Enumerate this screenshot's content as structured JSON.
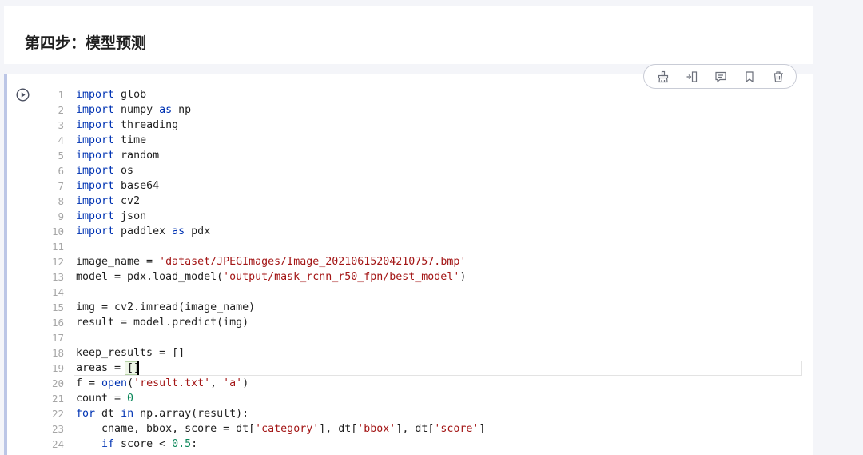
{
  "markdown": {
    "title": "第四步：模型预测"
  },
  "toolbar": {
    "buttons": [
      {
        "name": "clear-output",
        "icon": "broom-icon"
      },
      {
        "name": "insert-cell",
        "icon": "insert-cell-icon"
      },
      {
        "name": "comment",
        "icon": "comment-icon"
      },
      {
        "name": "bookmark",
        "icon": "bookmark-icon"
      },
      {
        "name": "delete",
        "icon": "trash-icon"
      }
    ]
  },
  "cell": {
    "run_icon": "play-circle-icon",
    "line_numbers": [
      "1",
      "2",
      "3",
      "4",
      "5",
      "6",
      "7",
      "8",
      "9",
      "10",
      "11",
      "12",
      "13",
      "14",
      "15",
      "16",
      "17",
      "18",
      "19",
      "20",
      "21",
      "22",
      "23",
      "24"
    ],
    "lines": [
      [
        [
          "kw",
          "import"
        ],
        [
          "p",
          " glob"
        ]
      ],
      [
        [
          "kw",
          "import"
        ],
        [
          "p",
          " numpy "
        ],
        [
          "kw",
          "as"
        ],
        [
          "p",
          " np"
        ]
      ],
      [
        [
          "kw",
          "import"
        ],
        [
          "p",
          " threading"
        ]
      ],
      [
        [
          "kw",
          "import"
        ],
        [
          "p",
          " time"
        ]
      ],
      [
        [
          "kw",
          "import"
        ],
        [
          "p",
          " random"
        ]
      ],
      [
        [
          "kw",
          "import"
        ],
        [
          "p",
          " os"
        ]
      ],
      [
        [
          "kw",
          "import"
        ],
        [
          "p",
          " base64"
        ]
      ],
      [
        [
          "kw",
          "import"
        ],
        [
          "p",
          " cv2"
        ]
      ],
      [
        [
          "kw",
          "import"
        ],
        [
          "p",
          " json"
        ]
      ],
      [
        [
          "kw",
          "import"
        ],
        [
          "p",
          " paddlex "
        ],
        [
          "kw",
          "as"
        ],
        [
          "p",
          " pdx"
        ]
      ],
      [],
      [
        [
          "p",
          "image_name = "
        ],
        [
          "str",
          "'dataset/JPEGImages/Image_20210615204210757.bmp'"
        ]
      ],
      [
        [
          "p",
          "model = pdx.load_model("
        ],
        [
          "str",
          "'output/mask_rcnn_r50_fpn/best_model'"
        ],
        [
          "p",
          ")"
        ]
      ],
      [],
      [
        [
          "p",
          "img = cv2.imread(image_name)"
        ]
      ],
      [
        [
          "p",
          "result = model.predict(img)"
        ]
      ],
      [],
      [
        [
          "p",
          "keep_results = []"
        ]
      ],
      [
        [
          "p",
          "areas = []"
        ]
      ],
      [
        [
          "p",
          "f = "
        ],
        [
          "bi",
          "open"
        ],
        [
          "p",
          "("
        ],
        [
          "str",
          "'result.txt'"
        ],
        [
          "p",
          ", "
        ],
        [
          "str",
          "'a'"
        ],
        [
          "p",
          ")"
        ]
      ],
      [
        [
          "p",
          "count = "
        ],
        [
          "num",
          "0"
        ]
      ],
      [
        [
          "kw",
          "for"
        ],
        [
          "p",
          " dt "
        ],
        [
          "kw",
          "in"
        ],
        [
          "p",
          " np.array(result):"
        ]
      ],
      [
        [
          "p",
          "    cname, bbox, score = dt["
        ],
        [
          "str",
          "'category'"
        ],
        [
          "p",
          "], dt["
        ],
        [
          "str",
          "'bbox'"
        ],
        [
          "p",
          "], dt["
        ],
        [
          "str",
          "'score'"
        ],
        [
          "p",
          "]"
        ]
      ],
      [
        [
          "p",
          "    "
        ],
        [
          "kw",
          "if"
        ],
        [
          "p",
          " score < "
        ],
        [
          "num",
          "0.5"
        ],
        [
          "p",
          ":"
        ]
      ]
    ]
  }
}
